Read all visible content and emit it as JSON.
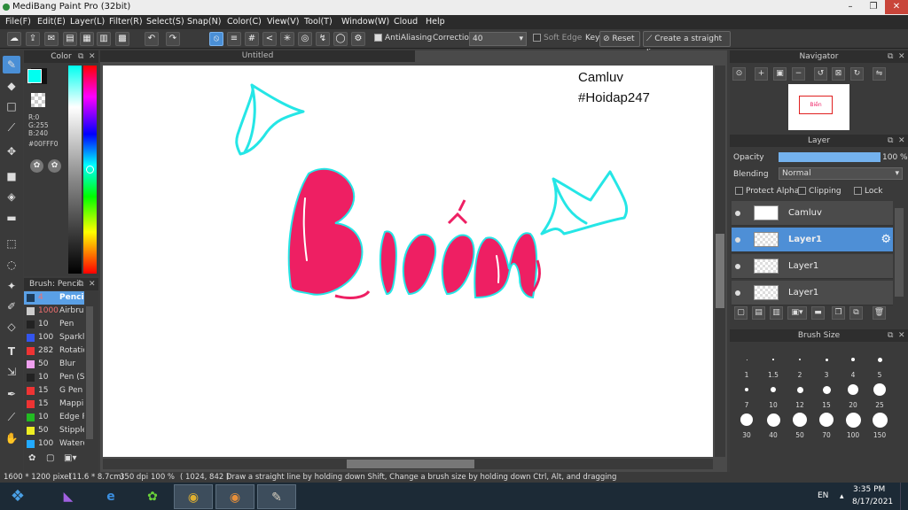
{
  "window": {
    "title": "MediBang Paint Pro (32bit)",
    "minimize": "–",
    "restore": "❐",
    "close": "✕"
  },
  "menu": [
    "File(F)",
    "Edit(E)",
    "Layer(L)",
    "Filter(R)",
    "Select(S)",
    "Snap(N)",
    "Color(C)",
    "View(V)",
    "Tool(T)",
    "Window(W)",
    "Cloud",
    "Help"
  ],
  "toolbar": {
    "antialias": "AntiAliasing",
    "correction_label": "Correction",
    "correction_value": "40",
    "soft_edge": "Soft Edge",
    "key": "Key",
    "reset": "Reset",
    "straight": "Create a straight line"
  },
  "color_panel": {
    "title": "Color",
    "r": "R:0",
    "g": "G:255",
    "b": "B:240",
    "hex": "#00FFF0",
    "foreground": "#00FFF0"
  },
  "brush_panel": {
    "title": "Brush: Pencil",
    "items": [
      {
        "size": "4",
        "name": "Pencil",
        "color": "#1e3c5a"
      },
      {
        "size": "1000",
        "name": "Airbrush",
        "color": "#cccccc"
      },
      {
        "size": "10",
        "name": "Pen",
        "color": "#222222"
      },
      {
        "size": "100",
        "name": "Sparkle",
        "color": "#3355ee"
      },
      {
        "size": "282",
        "name": "Rotation",
        "color": "#ee3333"
      },
      {
        "size": "50",
        "name": "Blur",
        "color": "#f0a0f0"
      },
      {
        "size": "10",
        "name": "Pen (S",
        "color": "#222222"
      },
      {
        "size": "15",
        "name": "G Pen",
        "color": "#ee3333"
      },
      {
        "size": "15",
        "name": "Mapping",
        "color": "#ee3333"
      },
      {
        "size": "10",
        "name": "Edge Pen",
        "color": "#22bb22"
      },
      {
        "size": "50",
        "name": "Stipple",
        "color": "#eeee22"
      },
      {
        "size": "100",
        "name": "Watercolor",
        "color": "#22aaff"
      }
    ]
  },
  "canvas": {
    "tab": "Untitled",
    "watermark_name": "Camluv",
    "watermark_tag": "#Hoidap247",
    "word": "Biền"
  },
  "status": {
    "size": "1600 * 1200 pixel",
    "cm": "(11.6 * 8.7cm)",
    "dpi": "350 dpi",
    "zoom": "100 %",
    "coords": "( 1024, 842 )",
    "hint": "Draw a straight line by holding down Shift, Change a brush size by holding down Ctrl, Alt, and dragging"
  },
  "navigator": {
    "title": "Navigator"
  },
  "layer_panel": {
    "title": "Layer",
    "opacity_label": "Opacity",
    "opacity_value": "100 %",
    "opacity_fraction": 1.0,
    "blending_label": "Blending",
    "blending_value": "Normal",
    "protect_alpha": "Protect Alpha",
    "clipping": "Clipping",
    "lock": "Lock",
    "layers": [
      {
        "name": "Camluv",
        "selected": false
      },
      {
        "name": "Layer1",
        "selected": true
      },
      {
        "name": "Layer1",
        "selected": false
      },
      {
        "name": "Layer1",
        "selected": false
      }
    ]
  },
  "brush_size": {
    "title": "Brush Size",
    "labels": [
      "1",
      "1.5",
      "2",
      "3",
      "4",
      "5",
      "7",
      "10",
      "12",
      "15",
      "20",
      "25",
      "30",
      "40",
      "50",
      "70",
      "100",
      "150"
    ]
  },
  "taskbar": {
    "lang": "EN",
    "time": "3:35 PM",
    "date": "8/17/2021"
  }
}
